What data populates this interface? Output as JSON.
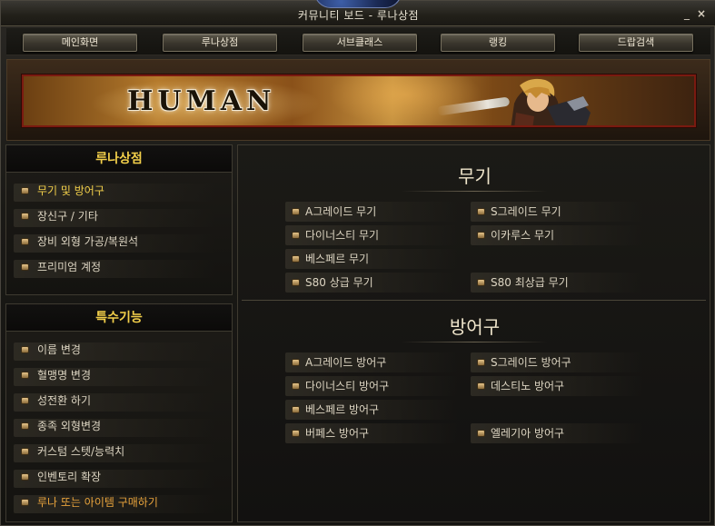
{
  "window": {
    "title": "커뮤니티 보드 - 루나상점",
    "minimize": "_",
    "close": "×"
  },
  "nav": [
    "메인화면",
    "루나상점",
    "서브클래스",
    "랭킹",
    "드랍검색"
  ],
  "banner": {
    "title": "HUMAN"
  },
  "luna_shop": {
    "header": "루나상점",
    "items": [
      "무기 및 방어구",
      "장신구 / 기타",
      "장비 외형 가공/복원석",
      "프리미엄 계정"
    ]
  },
  "special": {
    "header": "특수기능",
    "items": [
      "이름 변경",
      "혈맹명 변경",
      "성전환 하기",
      "종족 외형변경",
      "커스텀 스텟/능력치",
      "인벤토리 확장",
      "루나 또는 아이템 구매하기"
    ]
  },
  "weapons": {
    "title": "무기",
    "items": [
      "A그레이드 무기",
      "S그레이드 무기",
      "다이너스티 무기",
      "이카루스 무기",
      "베스페르 무기",
      "S80 상급 무기",
      "S80 최상급 무기"
    ]
  },
  "armor": {
    "title": "방어구",
    "items": [
      "A그레이드 방어구",
      "S그레이드 방어구",
      "다이너스티 방어구",
      "데스티노 방어구",
      "베스페르 방어구",
      "버페스 방어구",
      "엘레기아 방어구"
    ]
  },
  "colors": {
    "accent_gold": "#f2cf4a",
    "highlight_orange": "#e8a33c",
    "banner_border": "#7a1a10"
  }
}
